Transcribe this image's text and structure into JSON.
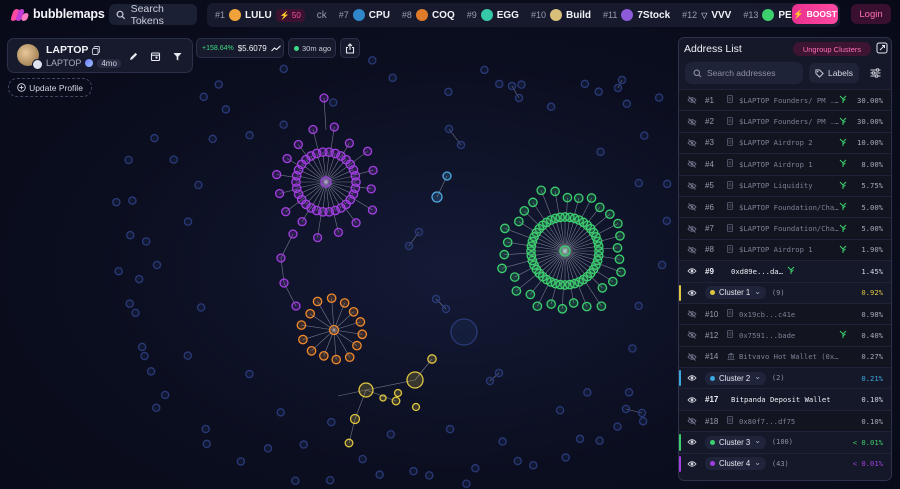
{
  "app": {
    "name": "bubblemaps"
  },
  "search": {
    "label": "Search Tokens"
  },
  "ticker": [
    {
      "rank": "#1",
      "name": "LULU",
      "coin": "#f0a33a",
      "boost": "50"
    },
    {
      "rank": "",
      "name": "ck",
      "coin": "",
      "boost": ""
    },
    {
      "rank": "#7",
      "name": "CPU",
      "coin": "#2f86c9",
      "boost": ""
    },
    {
      "rank": "#8",
      "name": "COQ",
      "coin": "#e07b2a",
      "boost": ""
    },
    {
      "rank": "#9",
      "name": "EGG",
      "coin": "#36c9a8",
      "boost": ""
    },
    {
      "rank": "#10",
      "name": "Build",
      "coin": "#d8c07a",
      "boost": ""
    },
    {
      "rank": "#11",
      "name": "7Stock",
      "coin": "#8d5ad9",
      "boost": ""
    },
    {
      "rank": "#12",
      "name": "VVV",
      "coin": "",
      "boost": ""
    },
    {
      "rank": "#13",
      "name": "PERF",
      "coin": "#3ccf6e",
      "boost": ""
    }
  ],
  "header": {
    "boost_label": "BOOST",
    "login_label": "Login"
  },
  "token": {
    "name": "LAPTOP",
    "symbol": "LAPTOP",
    "age": "4mo",
    "price_change": "+158.64%",
    "price": "$5.6079",
    "updated": "30m ago",
    "update_profile_label": "Update Profile"
  },
  "panel": {
    "title": "Address List",
    "ungroup_label": "Ungroup Clusters",
    "search_placeholder": "Search addresses",
    "labels_button": "Labels",
    "rows": [
      {
        "rank": "#1",
        "label": "$LAPTOP Founders/ PM ...",
        "pct": "30.00%",
        "kind": "file",
        "tree": true,
        "dim": true
      },
      {
        "rank": "#2",
        "label": "$LAPTOP Founders/ PM ...",
        "pct": "30.00%",
        "kind": "file",
        "tree": true,
        "dim": true
      },
      {
        "rank": "#3",
        "label": "$LAPTOP Airdrop 2",
        "pct": "10.00%",
        "kind": "file",
        "tree": true,
        "dim": true
      },
      {
        "rank": "#4",
        "label": "$LAPTOP Airdrop 1",
        "pct": "8.00%",
        "kind": "file",
        "tree": true,
        "dim": true
      },
      {
        "rank": "#5",
        "label": "$LAPTOP Liquidity",
        "pct": "5.75%",
        "kind": "file",
        "tree": true,
        "dim": true
      },
      {
        "rank": "#6",
        "label": "$LAPTOP Foundation/Cha...",
        "pct": "5.00%",
        "kind": "file",
        "tree": true,
        "dim": true
      },
      {
        "rank": "#7",
        "label": "$LAPTOP Foundation/Cha...",
        "pct": "5.00%",
        "kind": "file",
        "tree": true,
        "dim": true
      },
      {
        "rank": "#8",
        "label": "$LAPTOP Airdrop 1",
        "pct": "1.90%",
        "kind": "file",
        "tree": true,
        "dim": true
      },
      {
        "rank": "#9",
        "label": "0xd89e...da37",
        "pct": "1.45%",
        "kind": "addr",
        "tree": true,
        "dim": false,
        "bright": true
      },
      {
        "cluster": "Cluster 1",
        "count": "(9)",
        "pct": "0.92%",
        "color": "#e0c640"
      },
      {
        "rank": "#10",
        "label": "0x19cb...c41e",
        "pct": "0.98%",
        "kind": "file",
        "tree": false,
        "dim": true
      },
      {
        "rank": "#12",
        "label": "0x7591...bade",
        "pct": "0.40%",
        "kind": "file",
        "tree": true,
        "dim": true
      },
      {
        "rank": "#14",
        "label": "Bitvavo Hot Wallet (0xaB...",
        "pct": "0.27%",
        "kind": "bank",
        "tree": false,
        "dim": true
      },
      {
        "cluster": "Cluster 2",
        "count": "(2)",
        "pct": "0.21%",
        "color": "#3aa7e0"
      },
      {
        "rank": "#17",
        "label": "Bitpanda Deposit Wallet",
        "pct": "0.10%",
        "kind": "none",
        "tree": false,
        "dim": false,
        "bright": true
      },
      {
        "rank": "#18",
        "label": "0x80f7...df75",
        "pct": "0.10%",
        "kind": "file",
        "tree": false,
        "dim": true
      },
      {
        "cluster": "Cluster 3",
        "count": "(100)",
        "pct": "< 0.01%",
        "color": "#3ccf6e"
      },
      {
        "cluster": "Cluster 4",
        "count": "(43)",
        "pct": "< 0.01%",
        "color": "#a23fe0"
      }
    ]
  },
  "colors": {
    "accent": "#ff4aa2",
    "positive": "#3ddc84",
    "purple_cluster": "#a23fe0",
    "green_cluster": "#3ccf6e",
    "orange_cluster": "#f08a2c",
    "yellow_cluster": "#e0c640",
    "blue_bubble": "#4da8e0",
    "neutral_bubble": "#2a3a78"
  }
}
